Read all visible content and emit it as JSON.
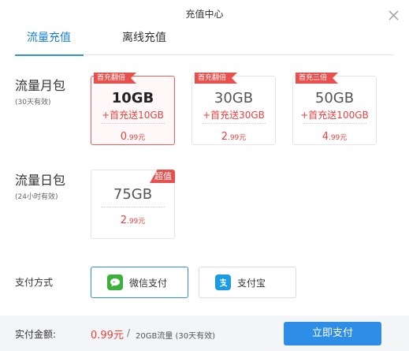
{
  "dialog": {
    "title": "充值中心"
  },
  "tabs": [
    {
      "label": "流量充值",
      "active": true
    },
    {
      "label": "离线充值",
      "active": false
    }
  ],
  "monthly": {
    "label": "流量月包",
    "sublabel": "(30天有效)",
    "cards": [
      {
        "ribbon": "首充翻倍",
        "amount": "10GB",
        "bonus": "+首充送10GB",
        "price_int": "0",
        "price_dec": ".99元",
        "selected": true
      },
      {
        "ribbon": "首充翻倍",
        "amount": "30GB",
        "bonus": "+首充送30GB",
        "price_int": "2",
        "price_dec": ".99元",
        "selected": false
      },
      {
        "ribbon": "首充三倍",
        "amount": "50GB",
        "bonus": "+首充送100GB",
        "price_int": "4",
        "price_dec": ".99元",
        "selected": false
      }
    ]
  },
  "daily": {
    "label": "流量日包",
    "sublabel": "(24小时有效)",
    "cards": [
      {
        "tag": "超值",
        "amount": "75GB",
        "price_int": "2",
        "price_dec": ".99元",
        "selected": false
      }
    ]
  },
  "payment": {
    "label": "支付方式",
    "options": [
      {
        "label": "微信支付",
        "icon": "wechat-icon",
        "color": "#3bb03b",
        "selected": true
      },
      {
        "label": "支付宝",
        "icon": "alipay-icon",
        "color": "#1a9be6",
        "selected": false
      }
    ]
  },
  "footer": {
    "amount_label": "实付金额:",
    "price": "0.99元",
    "separator": "/",
    "detail": "20GB流量 (30天有效)",
    "buy_label": "立即支付"
  },
  "colors": {
    "accent": "#2e8de6",
    "price_red": "#e8423f",
    "ribbon_red": "#e8504d"
  }
}
